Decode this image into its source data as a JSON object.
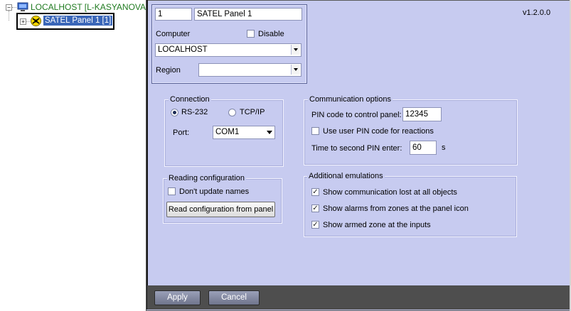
{
  "tree": {
    "root_label": "LOCALHOST [L-KASYANOVA]",
    "root_expander": "−",
    "child_label": "SATEL Panel 1 [1]",
    "child_expander": "+"
  },
  "settings": {
    "version": "v1.2.0.0",
    "header": {
      "id_value": "1",
      "name_value": "SATEL Panel 1",
      "computer_label": "Computer",
      "disable_label": "Disable",
      "computer_value": "LOCALHOST",
      "region_label": "Region",
      "region_value": ""
    },
    "connection": {
      "title": "Connection",
      "rs232_label": "RS-232",
      "tcpip_label": "TCP/IP",
      "port_label": "Port:",
      "port_value": "COM1"
    },
    "communication": {
      "title": "Communication options",
      "pin_label": "PIN code to control panel:",
      "pin_value": "12345",
      "user_pin_label": "Use user PIN code for reactions",
      "second_pin_label": "Time to second PIN enter:",
      "second_pin_value": "60",
      "second_pin_unit": "s"
    },
    "reading": {
      "title": "Reading configuration",
      "dont_update_label": "Don't update names",
      "read_button_label": "Read configuration from panel"
    },
    "emulations": {
      "title": "Additional emulations",
      "item1_label": "Show communication lost at all objects",
      "item2_label": "Show alarms from zones at the panel icon",
      "item3_label": "Show armed zone at the inputs"
    },
    "footer": {
      "apply_label": "Apply",
      "cancel_label": "Cancel"
    }
  },
  "icons": {
    "computer": "computer-icon",
    "panel": "satel-panel-icon",
    "check": "✓"
  }
}
